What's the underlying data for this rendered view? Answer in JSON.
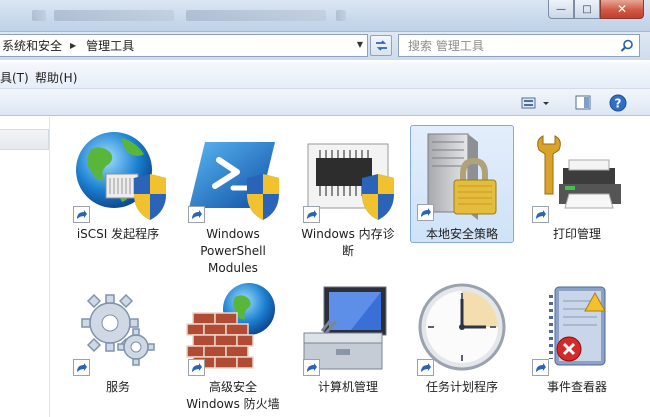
{
  "address": {
    "crumbs": [
      "系统和安全",
      "管理工具"
    ],
    "search_placeholder": "搜索 管理工具"
  },
  "window_buttons": {
    "minimize": "—",
    "maximize": "□",
    "close": "✕"
  },
  "menu": {
    "tools": "具(T)",
    "help": "帮助(H)"
  },
  "items": [
    {
      "label": "iSCSI 发起程序",
      "icon": "globe-shield-icon"
    },
    {
      "label": "Windows PowerShell Modules",
      "icon": "powershell-shield-icon"
    },
    {
      "label": "Windows 内存诊断",
      "icon": "memory-chip-shield-icon"
    },
    {
      "label": "本地安全策略",
      "icon": "server-lock-icon",
      "selected": true
    },
    {
      "label": "打印管理",
      "icon": "printer-wrench-icon"
    },
    {
      "label": "服务",
      "icon": "gears-icon"
    },
    {
      "label": "高级安全 Windows 防火墙",
      "icon": "firewall-globe-icon"
    },
    {
      "label": "计算机管理",
      "icon": "computer-toolbox-icon"
    },
    {
      "label": "任务计划程序",
      "icon": "clock-icon"
    },
    {
      "label": "事件查看器",
      "icon": "event-log-warning-icon"
    }
  ],
  "colors": {
    "selection": "#cfe2f8",
    "selection_border": "#84acdd",
    "close_button": "#c0402b"
  }
}
